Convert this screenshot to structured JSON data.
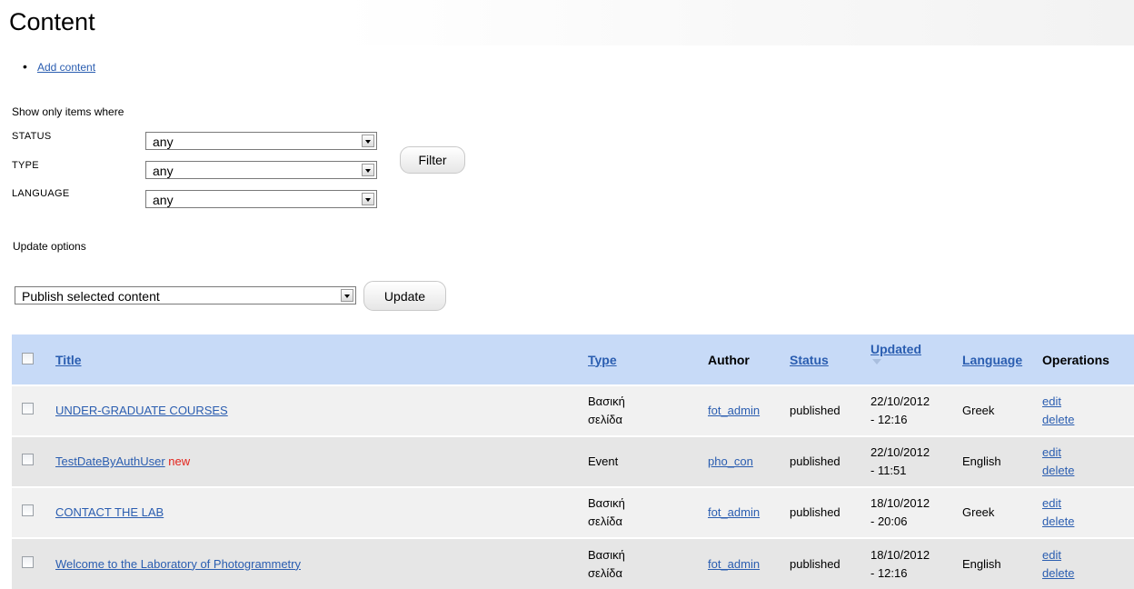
{
  "page": {
    "title": "Content",
    "add_content": "Add content"
  },
  "filters": {
    "heading": "Show only items where",
    "status": {
      "label": "STATUS",
      "value": "any"
    },
    "type": {
      "label": "TYPE",
      "value": "any"
    },
    "language": {
      "label": "LANGUAGE",
      "value": "any"
    },
    "filter_button": "Filter"
  },
  "update": {
    "heading": "Update options",
    "selected_option": "Publish selected content",
    "update_button": "Update"
  },
  "table": {
    "headers": {
      "title": "Title",
      "type": "Type",
      "author": "Author",
      "status": "Status",
      "updated": "Updated",
      "language": "Language",
      "operations": "Operations"
    },
    "rows": [
      {
        "title": "UNDER-GRADUATE COURSES",
        "new": "",
        "type_line1": "Βασική",
        "type_line2": "σελίδα",
        "author": "fot_admin",
        "status": "published",
        "date": "22/10/2012",
        "time": "- 12:16",
        "language": "Greek",
        "edit": "edit",
        "delete": "delete"
      },
      {
        "title": "TestDateByAuthUser",
        "new": "new",
        "type_line1": "Event",
        "type_line2": "",
        "author": "pho_con",
        "status": "published",
        "date": "22/10/2012",
        "time": "- 11:51",
        "language": "English",
        "edit": "edit",
        "delete": "delete"
      },
      {
        "title": "CONTACT THE LAB",
        "new": "",
        "type_line1": "Βασική",
        "type_line2": "σελίδα",
        "author": "fot_admin",
        "status": "published",
        "date": "18/10/2012",
        "time": "- 20:06",
        "language": "Greek",
        "edit": "edit",
        "delete": "delete"
      },
      {
        "title": "Welcome to the Laboratory of Photogrammetry",
        "new": "",
        "type_line1": "Βασική",
        "type_line2": "σελίδα",
        "author": "fot_admin",
        "status": "published",
        "date": "18/10/2012",
        "time": "- 12:16",
        "language": "English",
        "edit": "edit",
        "delete": "delete"
      }
    ]
  }
}
